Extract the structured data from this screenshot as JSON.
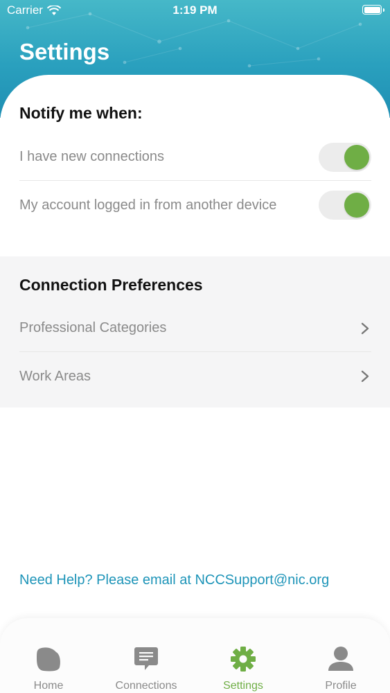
{
  "status_bar": {
    "carrier": "Carrier",
    "time": "1:19 PM"
  },
  "header": {
    "title": "Settings"
  },
  "notifications": {
    "title": "Notify me when:",
    "items": [
      {
        "label": "I have new connections",
        "enabled": true
      },
      {
        "label": "My account logged in from another device",
        "enabled": true
      }
    ]
  },
  "preferences": {
    "title": "Connection Preferences",
    "items": [
      {
        "label": "Professional Categories"
      },
      {
        "label": "Work Areas"
      }
    ]
  },
  "help": {
    "text": "Need Help? Please email at NCCSupport@nic.org"
  },
  "tabbar": {
    "items": [
      {
        "label": "Home",
        "icon": "home-icon",
        "active": false
      },
      {
        "label": "Connections",
        "icon": "chat-icon",
        "active": false
      },
      {
        "label": "Settings",
        "icon": "gear-icon",
        "active": true
      },
      {
        "label": "Profile",
        "icon": "user-icon",
        "active": false
      }
    ]
  },
  "colors": {
    "accent_green": "#6fae45",
    "header_teal": "#2aa0be",
    "link_blue": "#1d94b8",
    "inactive_gray": "#8a8a8a"
  }
}
